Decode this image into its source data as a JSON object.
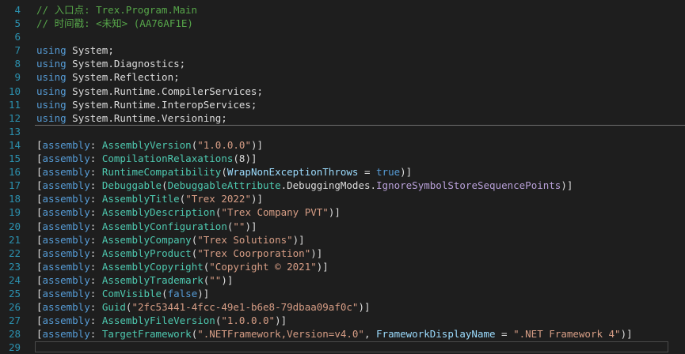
{
  "editor": {
    "lines": [
      {
        "n": "4",
        "tokens": [
          {
            "t": "// 入口点: Trex.Program.Main",
            "c": "comment"
          }
        ]
      },
      {
        "n": "5",
        "tokens": [
          {
            "t": "// 时间戳: <未知> (AA76AF1E)",
            "c": "comment"
          }
        ]
      },
      {
        "n": "6",
        "tokens": []
      },
      {
        "n": "7",
        "tokens": [
          {
            "t": "using",
            "c": "keyword"
          },
          {
            "t": " System;",
            "c": "plain"
          }
        ]
      },
      {
        "n": "8",
        "tokens": [
          {
            "t": "using",
            "c": "keyword"
          },
          {
            "t": " System.Diagnostics;",
            "c": "plain"
          }
        ]
      },
      {
        "n": "9",
        "tokens": [
          {
            "t": "using",
            "c": "keyword"
          },
          {
            "t": " System.Reflection;",
            "c": "plain"
          }
        ]
      },
      {
        "n": "10",
        "tokens": [
          {
            "t": "using",
            "c": "keyword"
          },
          {
            "t": " System.Runtime.CompilerServices;",
            "c": "plain"
          }
        ]
      },
      {
        "n": "11",
        "tokens": [
          {
            "t": "using",
            "c": "keyword"
          },
          {
            "t": " System.Runtime.InteropServices;",
            "c": "plain"
          }
        ]
      },
      {
        "n": "12",
        "tokens": [
          {
            "t": "using",
            "c": "keyword"
          },
          {
            "t": " System.Runtime.Versioning;",
            "c": "plain"
          }
        ]
      },
      {
        "n": "13",
        "tokens": []
      },
      {
        "n": "14",
        "tokens": [
          {
            "t": "[",
            "c": "plain"
          },
          {
            "t": "assembly",
            "c": "keyword"
          },
          {
            "t": ": ",
            "c": "plain"
          },
          {
            "t": "AssemblyVersion",
            "c": "type"
          },
          {
            "t": "(",
            "c": "plain"
          },
          {
            "t": "\"1.0.0.0\"",
            "c": "string"
          },
          {
            "t": ")]",
            "c": "plain"
          }
        ]
      },
      {
        "n": "15",
        "tokens": [
          {
            "t": "[",
            "c": "plain"
          },
          {
            "t": "assembly",
            "c": "keyword"
          },
          {
            "t": ": ",
            "c": "plain"
          },
          {
            "t": "CompilationRelaxations",
            "c": "type"
          },
          {
            "t": "(8)]",
            "c": "plain"
          }
        ]
      },
      {
        "n": "16",
        "tokens": [
          {
            "t": "[",
            "c": "plain"
          },
          {
            "t": "assembly",
            "c": "keyword"
          },
          {
            "t": ": ",
            "c": "plain"
          },
          {
            "t": "RuntimeCompatibility",
            "c": "type"
          },
          {
            "t": "(",
            "c": "plain"
          },
          {
            "t": "WrapNonExceptionThrows",
            "c": "param"
          },
          {
            "t": " = ",
            "c": "plain"
          },
          {
            "t": "true",
            "c": "keyword"
          },
          {
            "t": ")]",
            "c": "plain"
          }
        ]
      },
      {
        "n": "17",
        "tokens": [
          {
            "t": "[",
            "c": "plain"
          },
          {
            "t": "assembly",
            "c": "keyword"
          },
          {
            "t": ": ",
            "c": "plain"
          },
          {
            "t": "Debuggable",
            "c": "type"
          },
          {
            "t": "(",
            "c": "plain"
          },
          {
            "t": "DebuggableAttribute",
            "c": "type"
          },
          {
            "t": ".DebuggingModes.",
            "c": "plain"
          },
          {
            "t": "IgnoreSymbolStoreSequencePoints",
            "c": "enummem"
          },
          {
            "t": ")]",
            "c": "plain"
          }
        ]
      },
      {
        "n": "18",
        "tokens": [
          {
            "t": "[",
            "c": "plain"
          },
          {
            "t": "assembly",
            "c": "keyword"
          },
          {
            "t": ": ",
            "c": "plain"
          },
          {
            "t": "AssemblyTitle",
            "c": "type"
          },
          {
            "t": "(",
            "c": "plain"
          },
          {
            "t": "\"Trex 2022\"",
            "c": "string"
          },
          {
            "t": ")]",
            "c": "plain"
          }
        ]
      },
      {
        "n": "19",
        "tokens": [
          {
            "t": "[",
            "c": "plain"
          },
          {
            "t": "assembly",
            "c": "keyword"
          },
          {
            "t": ": ",
            "c": "plain"
          },
          {
            "t": "AssemblyDescription",
            "c": "type"
          },
          {
            "t": "(",
            "c": "plain"
          },
          {
            "t": "\"Trex Company PVT\"",
            "c": "string"
          },
          {
            "t": ")]",
            "c": "plain"
          }
        ]
      },
      {
        "n": "20",
        "tokens": [
          {
            "t": "[",
            "c": "plain"
          },
          {
            "t": "assembly",
            "c": "keyword"
          },
          {
            "t": ": ",
            "c": "plain"
          },
          {
            "t": "AssemblyConfiguration",
            "c": "type"
          },
          {
            "t": "(",
            "c": "plain"
          },
          {
            "t": "\"\"",
            "c": "string"
          },
          {
            "t": ")]",
            "c": "plain"
          }
        ]
      },
      {
        "n": "21",
        "tokens": [
          {
            "t": "[",
            "c": "plain"
          },
          {
            "t": "assembly",
            "c": "keyword"
          },
          {
            "t": ": ",
            "c": "plain"
          },
          {
            "t": "AssemblyCompany",
            "c": "type"
          },
          {
            "t": "(",
            "c": "plain"
          },
          {
            "t": "\"Trex Solutions\"",
            "c": "string"
          },
          {
            "t": ")]",
            "c": "plain"
          }
        ]
      },
      {
        "n": "22",
        "tokens": [
          {
            "t": "[",
            "c": "plain"
          },
          {
            "t": "assembly",
            "c": "keyword"
          },
          {
            "t": ": ",
            "c": "plain"
          },
          {
            "t": "AssemblyProduct",
            "c": "type"
          },
          {
            "t": "(",
            "c": "plain"
          },
          {
            "t": "\"Trex Coorporation\"",
            "c": "string"
          },
          {
            "t": ")]",
            "c": "plain"
          }
        ]
      },
      {
        "n": "23",
        "tokens": [
          {
            "t": "[",
            "c": "plain"
          },
          {
            "t": "assembly",
            "c": "keyword"
          },
          {
            "t": ": ",
            "c": "plain"
          },
          {
            "t": "AssemblyCopyright",
            "c": "type"
          },
          {
            "t": "(",
            "c": "plain"
          },
          {
            "t": "\"Copyright © 2021\"",
            "c": "string"
          },
          {
            "t": ")]",
            "c": "plain"
          }
        ]
      },
      {
        "n": "24",
        "tokens": [
          {
            "t": "[",
            "c": "plain"
          },
          {
            "t": "assembly",
            "c": "keyword"
          },
          {
            "t": ": ",
            "c": "plain"
          },
          {
            "t": "AssemblyTrademark",
            "c": "type"
          },
          {
            "t": "(",
            "c": "plain"
          },
          {
            "t": "\"\"",
            "c": "string"
          },
          {
            "t": ")]",
            "c": "plain"
          }
        ]
      },
      {
        "n": "25",
        "tokens": [
          {
            "t": "[",
            "c": "plain"
          },
          {
            "t": "assembly",
            "c": "keyword"
          },
          {
            "t": ": ",
            "c": "plain"
          },
          {
            "t": "ComVisible",
            "c": "type"
          },
          {
            "t": "(",
            "c": "plain"
          },
          {
            "t": "false",
            "c": "keyword"
          },
          {
            "t": ")]",
            "c": "plain"
          }
        ]
      },
      {
        "n": "26",
        "tokens": [
          {
            "t": "[",
            "c": "plain"
          },
          {
            "t": "assembly",
            "c": "keyword"
          },
          {
            "t": ": ",
            "c": "plain"
          },
          {
            "t": "Guid",
            "c": "type"
          },
          {
            "t": "(",
            "c": "plain"
          },
          {
            "t": "\"2fc53441-4fcc-49e1-b6e8-79dbaa09af0c\"",
            "c": "string"
          },
          {
            "t": ")]",
            "c": "plain"
          }
        ]
      },
      {
        "n": "27",
        "tokens": [
          {
            "t": "[",
            "c": "plain"
          },
          {
            "t": "assembly",
            "c": "keyword"
          },
          {
            "t": ": ",
            "c": "plain"
          },
          {
            "t": "AssemblyFileVersion",
            "c": "type"
          },
          {
            "t": "(",
            "c": "plain"
          },
          {
            "t": "\"1.0.0.0\"",
            "c": "string"
          },
          {
            "t": ")]",
            "c": "plain"
          }
        ]
      },
      {
        "n": "28",
        "tokens": [
          {
            "t": "[",
            "c": "plain"
          },
          {
            "t": "assembly",
            "c": "keyword"
          },
          {
            "t": ": ",
            "c": "plain"
          },
          {
            "t": "TargetFramework",
            "c": "type"
          },
          {
            "t": "(",
            "c": "plain"
          },
          {
            "t": "\".NETFramework,Version=v4.0\"",
            "c": "string"
          },
          {
            "t": ", ",
            "c": "plain"
          },
          {
            "t": "FrameworkDisplayName",
            "c": "param"
          },
          {
            "t": " = ",
            "c": "plain"
          },
          {
            "t": "\".NET Framework 4\"",
            "c": "string"
          },
          {
            "t": ")]",
            "c": "plain"
          }
        ]
      },
      {
        "n": "29",
        "tokens": []
      }
    ]
  },
  "colors": {
    "background": "#1e1e1e",
    "line_number": "#2b91af",
    "comment": "#57a64a",
    "keyword": "#569cd6",
    "type": "#4ec9b0",
    "string": "#d69d85"
  }
}
